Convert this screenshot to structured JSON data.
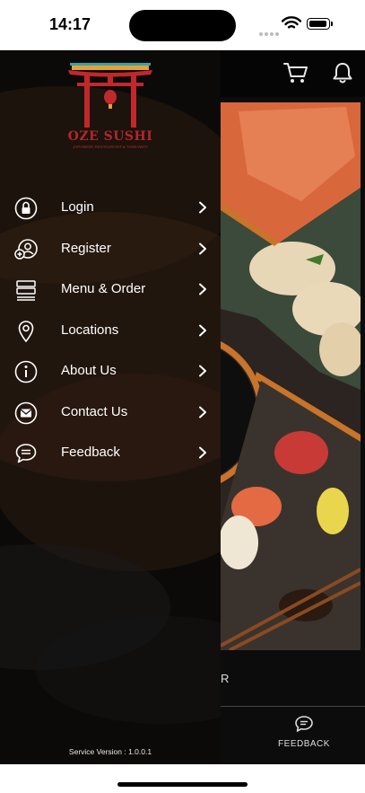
{
  "status_bar": {
    "time": "14:17"
  },
  "drawer": {
    "logo": {
      "title": "OZE SUSHI",
      "subtitle": "JAPANESE RESTAURANT & TAKEAWAY"
    },
    "menu_items": [
      {
        "label": "Login",
        "icon": "lock-icon"
      },
      {
        "label": "Register",
        "icon": "add-user-icon"
      },
      {
        "label": "Menu & Order",
        "icon": "menu-list-icon"
      },
      {
        "label": "Locations",
        "icon": "location-pin-icon"
      },
      {
        "label": "About Us",
        "icon": "info-icon"
      },
      {
        "label": "Contact Us",
        "icon": "mail-icon"
      },
      {
        "label": "Feedback",
        "icon": "chat-bubble-icon"
      }
    ],
    "service_version": "Service Version : 1.0.0.1"
  },
  "background_screen": {
    "bottom_text": "R",
    "bottom_tab": {
      "label": "FEEDBACK",
      "icon": "chat-bubble-icon"
    }
  },
  "colors": {
    "accent_brown": "#c8742a",
    "logo_red": "#b3262b",
    "drawer_text": "#ffffff"
  }
}
